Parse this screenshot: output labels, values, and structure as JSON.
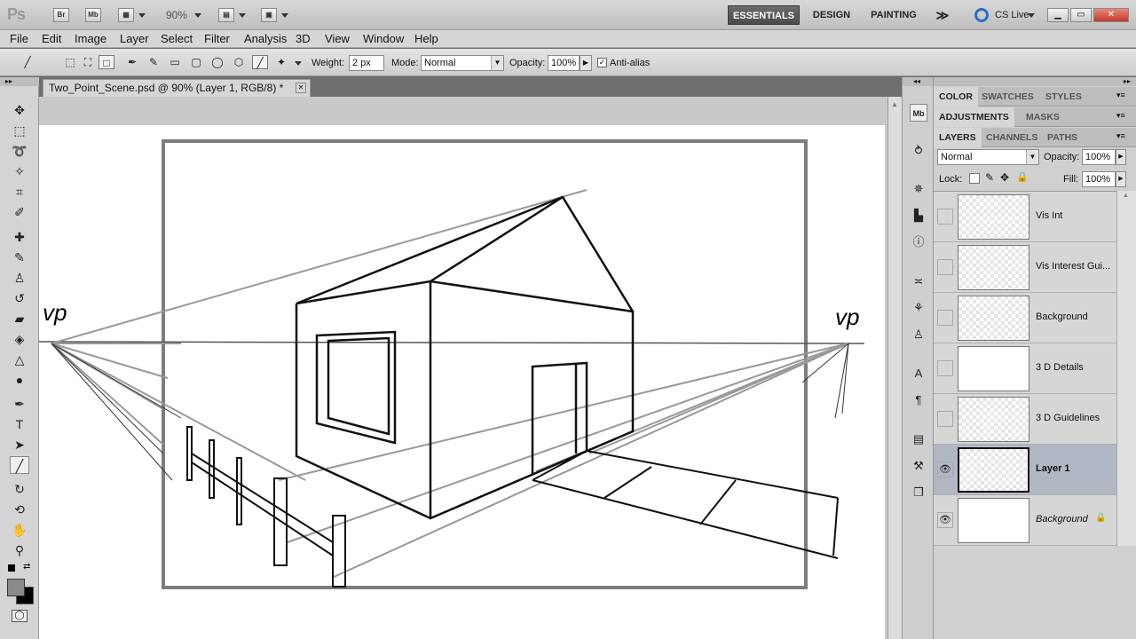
{
  "app": {
    "logo": "Ps",
    "zoom": "90%"
  },
  "appbar": {
    "bridge": "Br",
    "minibridge": "Mb",
    "workspaces": [
      "ESSENTIALS",
      "DESIGN",
      "PAINTING"
    ],
    "more": "≫",
    "cslive": "CS Live"
  },
  "menu": [
    "File",
    "Edit",
    "Image",
    "Layer",
    "Select",
    "Filter",
    "Analysis",
    "3D",
    "View",
    "Window",
    "Help"
  ],
  "options": {
    "weight_label": "Weight:",
    "weight_value": "2 px",
    "mode_label": "Mode:",
    "mode_value": "Normal",
    "opacity_label": "Opacity:",
    "opacity_value": "100%",
    "antialias_label": "Anti-alias",
    "antialias_checked": true
  },
  "document": {
    "tab_title": "Two_Point_Scene.psd @ 90% (Layer 1, RGB/8) *",
    "close": "✕"
  },
  "drawing": {
    "vp_left": "vp",
    "vp_right": "vp"
  },
  "panels": {
    "group1": [
      "COLOR",
      "SWATCHES",
      "STYLES"
    ],
    "group2": [
      "ADJUSTMENTS",
      "MASKS"
    ],
    "group3": [
      "LAYERS",
      "CHANNELS",
      "PATHS"
    ],
    "blend_mode": "Normal",
    "opacity_label": "Opacity:",
    "opacity_value": "100%",
    "lock_label": "Lock:",
    "fill_label": "Fill:",
    "fill_value": "100%"
  },
  "layers": [
    {
      "name": "Vis Int",
      "visible": false,
      "selected": false
    },
    {
      "name": "Vis Interest Gui...",
      "visible": false,
      "selected": false
    },
    {
      "name": "Background",
      "visible": false,
      "selected": false
    },
    {
      "name": "3 D Details",
      "visible": false,
      "selected": false
    },
    {
      "name": "3 D Guidelines",
      "visible": false,
      "selected": false
    },
    {
      "name": "Layer 1",
      "visible": true,
      "selected": true
    },
    {
      "name": "Background",
      "visible": true,
      "selected": false,
      "locked": true
    }
  ],
  "colors": {
    "accent_selected_layer": "#b2b7c4",
    "workspace_active": "#4a4a4a"
  }
}
